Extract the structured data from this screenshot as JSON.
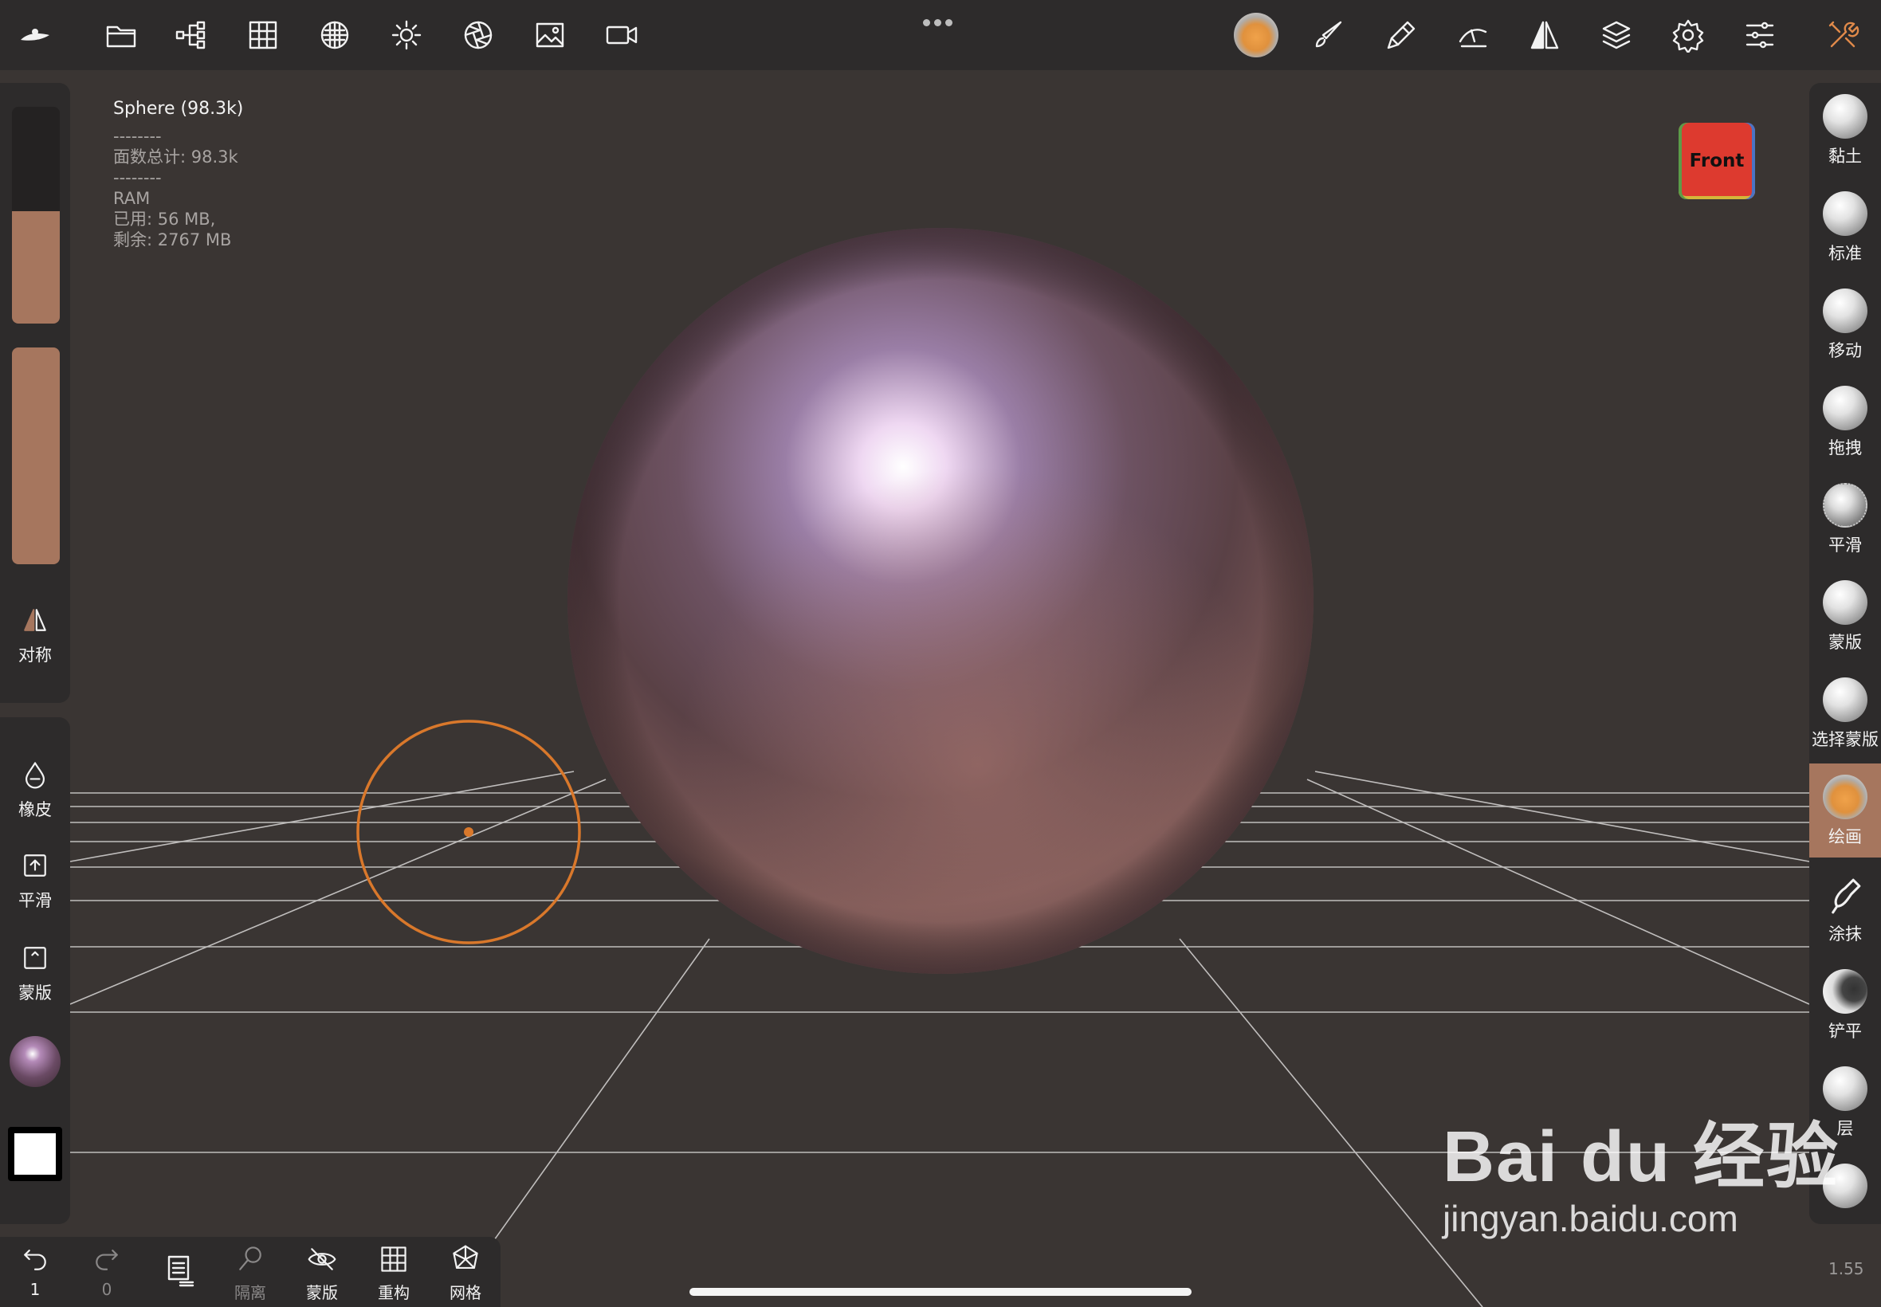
{
  "app": {
    "top_toolbar": [
      "home-menu-icon",
      "folder-icon",
      "scene-tree-icon",
      "grid-icon",
      "topology-icon",
      "light-icon",
      "aperture-icon",
      "image-icon",
      "video-camera-icon"
    ],
    "right_toolbar": [
      "material-sphere",
      "brush-icon",
      "paint-icon",
      "stroke-icon",
      "symmetry-icon",
      "layers-icon",
      "settings-icon",
      "sliders-icon",
      "tools-icon"
    ]
  },
  "info": {
    "object": "Sphere (98.3k)",
    "sep": "--------",
    "faces": "面数总计:  98.3k",
    "ram_label": "RAM",
    "ram_used": "已用:  56 MB,",
    "ram_free": "剩余:  2767 MB"
  },
  "view_cube": {
    "label": "Front"
  },
  "left_panel": {
    "radius_level": 0.52,
    "intensity_level": 1.0,
    "symmetry": "对称",
    "eraser": "橡皮",
    "smooth": "平滑",
    "mask": "蒙版"
  },
  "tools": [
    {
      "label": "黏土",
      "active": false
    },
    {
      "label": "标准",
      "active": false
    },
    {
      "label": "移动",
      "active": false
    },
    {
      "label": "拖拽",
      "active": false
    },
    {
      "label": "平滑",
      "active": false
    },
    {
      "label": "蒙版",
      "active": false
    },
    {
      "label": "选择蒙版",
      "active": false
    },
    {
      "label": "绘画",
      "active": true
    },
    {
      "label": "涂抹",
      "active": false
    },
    {
      "label": "铲平",
      "active": false
    },
    {
      "label": "层",
      "active": false
    }
  ],
  "bottom": {
    "undo_count": "1",
    "redo_count": "0",
    "isolate": "隔离",
    "mask": "蒙版",
    "remesh": "重构",
    "mesh": "网格"
  },
  "colors": {
    "accent": "#a6765e",
    "panel": "#2d2b2b",
    "viewport": "#3a3533",
    "brush_ring": "#d9782b"
  },
  "version": "1.55",
  "watermark": {
    "brand": "Bai du 经验",
    "url": "jingyan.baidu.com"
  }
}
